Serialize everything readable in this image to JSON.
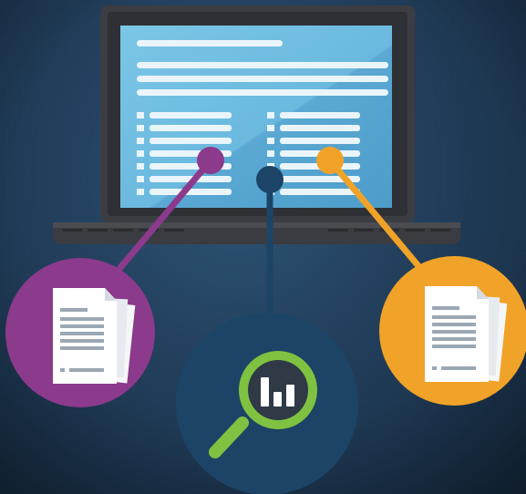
{
  "illustration": {
    "colors": {
      "background": "#223f5c",
      "screen_light": "#77c3e3",
      "screen_dark": "#5aaed6",
      "laptop_frame": "#3b3d42",
      "purple": "#8b3a8c",
      "orange": "#f0a328",
      "navy": "#1c4466",
      "magnifier_green": "#7fc241"
    },
    "icons": [
      "laptop-icon",
      "document-stack-icon",
      "magnifier-chart-icon",
      "document-stack-icon"
    ]
  }
}
